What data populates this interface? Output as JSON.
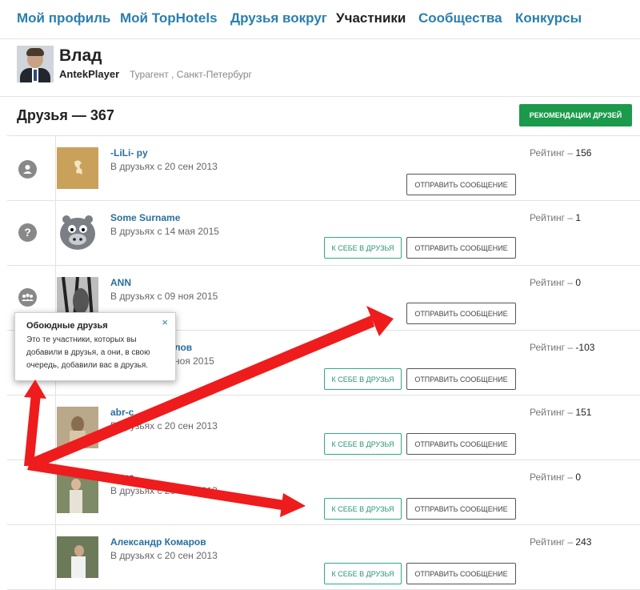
{
  "nav": [
    {
      "label": "Мой профиль"
    },
    {
      "label": "Мой TopHotels"
    },
    {
      "label": "Друзья вокруг"
    },
    {
      "label": "Участники"
    },
    {
      "label": "Сообщества"
    },
    {
      "label": "Конкурсы"
    }
  ],
  "profile": {
    "name": "Влад",
    "login": "AntekPlayer",
    "meta": "Турагент , Санкт-Петербург"
  },
  "friends": {
    "title": "Друзья — 367",
    "recommend_label": "РЕКОМЕНДАЦИИ ДРУЗЕЙ"
  },
  "rows": [
    {
      "name": "-LiLi- py",
      "since": "В друзьях с 20 сен 2013",
      "rating_label": "Рейтинг –",
      "rating": "156",
      "add_label": "",
      "msg_label": "ОТПРАВИТЬ СООБЩЕНИЕ",
      "icon": "user-icon"
    },
    {
      "name": "Some Surname",
      "since": "В друзьях с 14 мая 2015",
      "rating_label": "Рейтинг –",
      "rating": "1",
      "add_label": "К СЕБЕ В ДРУЗЬЯ",
      "msg_label": "ОТПРАВИТЬ СООБЩЕНИЕ",
      "icon": "question-icon"
    },
    {
      "name": "ANN",
      "since": "В друзьях с 09 ноя 2015",
      "rating_label": "Рейтинг –",
      "rating": "0",
      "add_label": "",
      "msg_label": "ОТПРАВИТЬ СООБЩЕНИЕ",
      "icon": "mutual-friends-icon"
    },
    {
      "name": "лов",
      "since": "ноя 2015",
      "rating_label": "Рейтинг –",
      "rating": "-103",
      "add_label": "К СЕБЕ В ДРУЗЬЯ",
      "msg_label": "ОТПРАВИТЬ СООБЩЕНИЕ",
      "icon": ""
    },
    {
      "name": "abr-c",
      "since": "В друзьях с 20 сен 2013",
      "rating_label": "Рейтинг –",
      "rating": "151",
      "add_label": "К СЕБЕ В ДРУЗЬЯ",
      "msg_label": "ОТПРАВИТЬ СООБЩЕНИЕ",
      "icon": ""
    },
    {
      "name": "Анна",
      "since": "В друзьях с 20 сен 2013",
      "rating_label": "Рейтинг –",
      "rating": "0",
      "add_label": "К СЕБЕ В ДРУЗЬЯ",
      "msg_label": "ОТПРАВИТЬ СООБЩЕНИЕ",
      "icon": ""
    },
    {
      "name": "Александр Комаров",
      "since": "В друзьях с 20 сен 2013",
      "rating_label": "Рейтинг –",
      "rating": "243",
      "add_label": "К СЕБЕ В ДРУЗЬЯ",
      "msg_label": "ОТПРАВИТЬ СООБЩЕНИЕ",
      "icon": ""
    }
  ],
  "popup": {
    "title": "Обоюдные друзья",
    "text": "Это те участники, которых вы добавили в друзья, а они, в свою очередь, добавили вас в друзья.",
    "close": "×"
  },
  "colors": {
    "accent": "#2a7fae",
    "green": "#1b9a4b",
    "arrow": "#ee1c1c"
  }
}
